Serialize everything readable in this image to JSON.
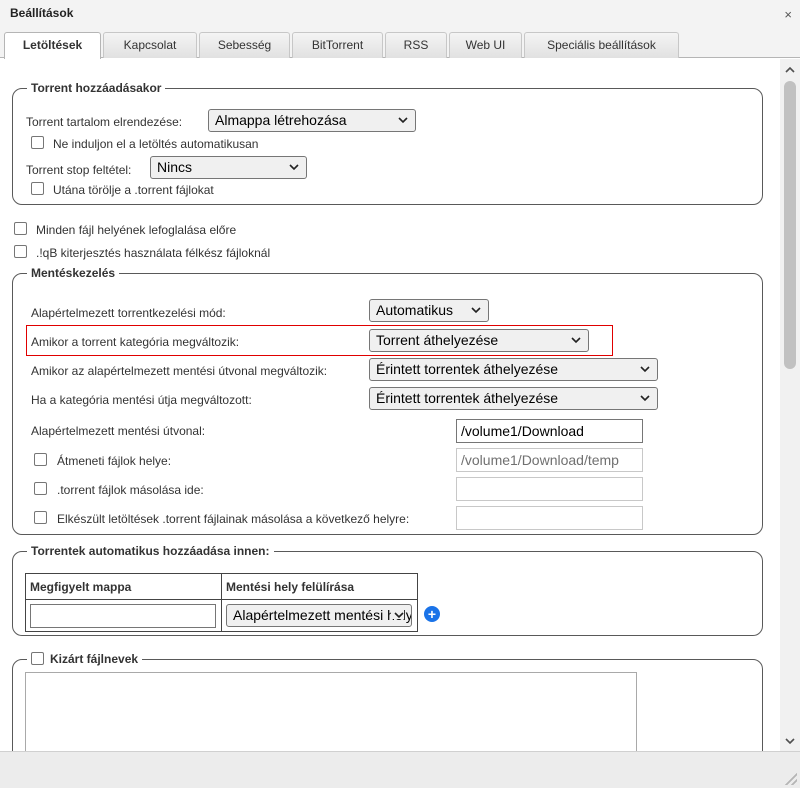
{
  "window": {
    "title": "Beállítások",
    "close": "×"
  },
  "tabs": [
    {
      "label": "Letöltések",
      "active": true
    },
    {
      "label": "Kapcsolat"
    },
    {
      "label": "Sebesség"
    },
    {
      "label": "BitTorrent"
    },
    {
      "label": "RSS"
    },
    {
      "label": "Web UI"
    },
    {
      "label": "Speciális beállítások"
    }
  ],
  "add_torrent": {
    "legend": "Torrent hozzáadásakor",
    "layout_label": "Torrent tartalom elrendezése:",
    "layout_value": "Almappa létrehozása",
    "no_autostart": "Ne induljon el a letöltés automatikusan",
    "stop_label": "Torrent stop feltétel:",
    "stop_value": "Nincs",
    "delete_torrent": "Utána törölje a .torrent fájlokat"
  },
  "preallocate": "Minden fájl helyének lefoglalása előre",
  "ext_iqb": ".!qB kiterjesztés használata félkész fájloknál",
  "saving": {
    "legend": "Mentéskezelés",
    "mode_label": "Alapértelmezett torrentkezelési mód:",
    "mode_value": "Automatikus",
    "cat_changed_label": "Amikor a torrent kategória megváltozik:",
    "cat_changed_value": "Torrent áthelyezése",
    "default_path_changed_label": "Amikor az alapértelmezett mentési útvonal megváltozik:",
    "default_path_changed_value": "Érintett torrentek áthelyezése",
    "cat_path_changed_label": "Ha a kategória mentési útja megváltozott:",
    "cat_path_changed_value": "Érintett torrentek áthelyezése",
    "save_path_label": "Alapértelmezett mentési útvonal:",
    "save_path_value": "/volume1/Download",
    "temp_label": "Átmeneti fájlok helye:",
    "temp_value": "/volume1/Download/temp",
    "copy_torrent_label": ".torrent fájlok másolása ide:",
    "copy_finished_label": "Elkészült letöltések .torrent fájlainak másolása a következő helyre:"
  },
  "watched": {
    "legend": "Torrentek automatikus hozzáadása innen:",
    "col_folder": "Megfigyelt mappa",
    "col_override": "Mentési hely felülírása",
    "override_value": "Alapértelmezett mentési hely",
    "add": "+"
  },
  "excluded": {
    "legend": "Kizárt fájlnevek"
  },
  "scroll": {
    "up": "^",
    "down": "v"
  }
}
